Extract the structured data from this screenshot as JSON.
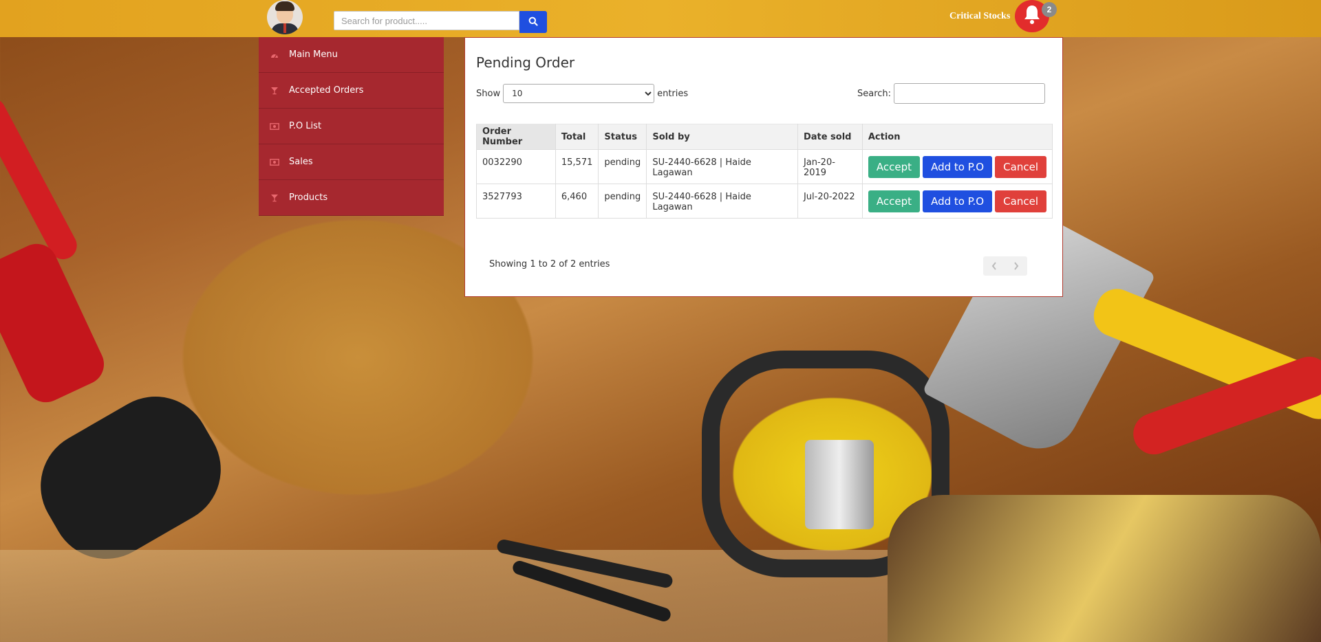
{
  "header": {
    "search_placeholder": "Search for product.....",
    "critical_label": "Critical Stocks",
    "notification_count": "2",
    "icons": {
      "search": "search-icon",
      "bell": "bell-icon",
      "avatar": "user-avatar"
    }
  },
  "sidebar": {
    "items": [
      {
        "label": "Main Menu",
        "icon": "dashboard-icon"
      },
      {
        "label": "Accepted Orders",
        "icon": "cocktail-icon"
      },
      {
        "label": "P.O List",
        "icon": "money-icon"
      },
      {
        "label": "Sales",
        "icon": "money-icon"
      },
      {
        "label": "Products",
        "icon": "cocktail-icon"
      }
    ]
  },
  "panel": {
    "title": "Pending Order",
    "show_label": "Show",
    "entries_label": "entries",
    "page_length": "10",
    "page_length_options": [
      "10"
    ],
    "search_label": "Search:",
    "search_value": "",
    "columns": [
      "Order Number",
      "Total",
      "Status",
      "Sold by",
      "Date sold",
      "Action"
    ],
    "rows": [
      {
        "order_number": "0032290",
        "total": "15,571",
        "status": "pending",
        "sold_by": "SU-2440-6628 | Haide Lagawan",
        "date_sold": "Jan-20-2019"
      },
      {
        "order_number": "3527793",
        "total": "6,460",
        "status": "pending",
        "sold_by": "SU-2440-6628 | Haide Lagawan",
        "date_sold": "Jul-20-2022"
      }
    ],
    "actions": {
      "accept": "Accept",
      "add_po": "Add to P.O",
      "cancel": "Cancel"
    },
    "info": "Showing 1 to 2 of 2 entries"
  },
  "colors": {
    "topbar": "#e2a21f",
    "sidebar": "#a6282f",
    "accept": "#3aaf85",
    "add_po": "#1f4fe0",
    "cancel": "#e0403b",
    "bell": "#e22c2c"
  }
}
